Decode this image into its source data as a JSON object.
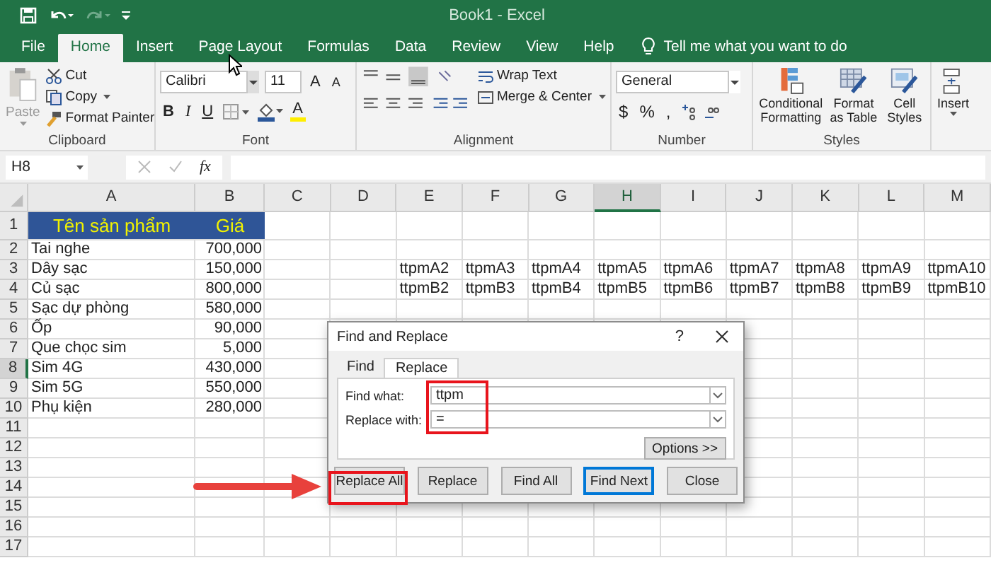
{
  "window": {
    "title": "Book1  -  Excel"
  },
  "ribbon_tabs": [
    {
      "label": "File",
      "selected": false
    },
    {
      "label": "Home",
      "selected": true
    },
    {
      "label": "Insert",
      "selected": false
    },
    {
      "label": "Page Layout",
      "selected": false
    },
    {
      "label": "Formulas",
      "selected": false
    },
    {
      "label": "Data",
      "selected": false
    },
    {
      "label": "Review",
      "selected": false
    },
    {
      "label": "View",
      "selected": false
    },
    {
      "label": "Help",
      "selected": false
    }
  ],
  "tell_me": {
    "placeholder": "Tell me what you want to do"
  },
  "clipboard": {
    "label": "Clipboard",
    "paste": {
      "label": "Paste",
      "disabled": true
    },
    "cut": "Cut",
    "copy": "Copy",
    "format_painter": "Format Painter"
  },
  "font": {
    "label": "Font",
    "font_name": "Calibri",
    "font_size": "11",
    "grow": "A",
    "shrink": "A",
    "bold": "B",
    "italic": "I",
    "underline": "U",
    "font_color": "A"
  },
  "alignment": {
    "label": "Alignment",
    "wrap_text": "Wrap Text",
    "merge_center": "Merge & Center"
  },
  "number": {
    "label": "Number",
    "format": "General",
    "currency": "$",
    "percent": "%",
    "comma": ","
  },
  "styles": {
    "label": "Styles",
    "items": [
      "Conditional Formatting",
      "Format as Table",
      "Cell Styles"
    ]
  },
  "cells": {
    "items": [
      "Insert"
    ]
  },
  "formula_bar": {
    "name_box": "H8",
    "fx": "fx"
  },
  "sheet": {
    "columns": [
      {
        "label": "A",
        "selected": false
      },
      {
        "label": "B",
        "selected": false
      },
      {
        "label": "C",
        "selected": false
      },
      {
        "label": "D",
        "selected": false
      },
      {
        "label": "E",
        "selected": false
      },
      {
        "label": "F",
        "selected": false
      },
      {
        "label": "G",
        "selected": false
      },
      {
        "label": "H",
        "selected": true
      },
      {
        "label": "I",
        "selected": false
      },
      {
        "label": "J",
        "selected": false
      },
      {
        "label": "K",
        "selected": false
      },
      {
        "label": "L",
        "selected": false
      },
      {
        "label": "M",
        "selected": false
      }
    ],
    "rows": [
      {
        "number": "1",
        "selected": false,
        "kind": "header",
        "name": "Tên sản phẩm",
        "price": "Giá"
      },
      {
        "number": "2",
        "selected": false,
        "kind": "data",
        "name": "Tai nghe",
        "price": "700,000"
      },
      {
        "number": "3",
        "selected": false,
        "kind": "data",
        "name": "Dây sạc",
        "price": "150,000",
        "codes": [
          "ttpmA2",
          "ttpmA3",
          "ttpmA4",
          "ttpmA5",
          "ttpmA6",
          "ttpmA7",
          "ttpmA8",
          "ttpmA9",
          "ttpmA10"
        ]
      },
      {
        "number": "4",
        "selected": false,
        "kind": "data",
        "name": "Củ sạc",
        "price": "800,000",
        "codes": [
          "ttpmB2",
          "ttpmB3",
          "ttpmB4",
          "ttpmB5",
          "ttpmB6",
          "ttpmB7",
          "ttpmB8",
          "ttpmB9",
          "ttpmB10"
        ]
      },
      {
        "number": "5",
        "selected": false,
        "kind": "data",
        "name": "Sạc dự phòng",
        "price": "580,000"
      },
      {
        "number": "6",
        "selected": false,
        "kind": "data",
        "name": "Ốp",
        "price": "90,000"
      },
      {
        "number": "7",
        "selected": false,
        "kind": "data",
        "name": "Que chọc sim",
        "price": "5,000"
      },
      {
        "number": "8",
        "selected": true,
        "kind": "data",
        "name": "Sim 4G",
        "price": "430,000"
      },
      {
        "number": "9",
        "selected": false,
        "kind": "data",
        "name": "Sim 5G",
        "price": "550,000"
      },
      {
        "number": "10",
        "selected": false,
        "kind": "data",
        "name": "Phụ kiện",
        "price": "280,000"
      },
      {
        "number": "11",
        "selected": false,
        "kind": "data"
      },
      {
        "number": "12",
        "selected": false,
        "kind": "data"
      },
      {
        "number": "13",
        "selected": false,
        "kind": "data"
      },
      {
        "number": "14",
        "selected": false,
        "kind": "data"
      },
      {
        "number": "15",
        "selected": false,
        "kind": "data"
      },
      {
        "number": "16",
        "selected": false,
        "kind": "data"
      },
      {
        "number": "17",
        "selected": false,
        "kind": "data"
      }
    ]
  },
  "dialog": {
    "title": "Find and Replace",
    "help": "?",
    "tabs": [
      {
        "label": "Find",
        "selected": false
      },
      {
        "label": "Replace",
        "selected": true
      }
    ],
    "fields": [
      {
        "label": "Find what:",
        "value": "ttpm"
      },
      {
        "label": "Replace with:",
        "value": "="
      }
    ],
    "options_button": "Options >>",
    "buttons": [
      {
        "label": "Replace All",
        "default": false
      },
      {
        "label": "Replace",
        "default": false
      },
      {
        "label": "Find All",
        "default": false
      },
      {
        "label": "Find Next",
        "default": true
      },
      {
        "label": "Close",
        "default": false
      }
    ]
  }
}
